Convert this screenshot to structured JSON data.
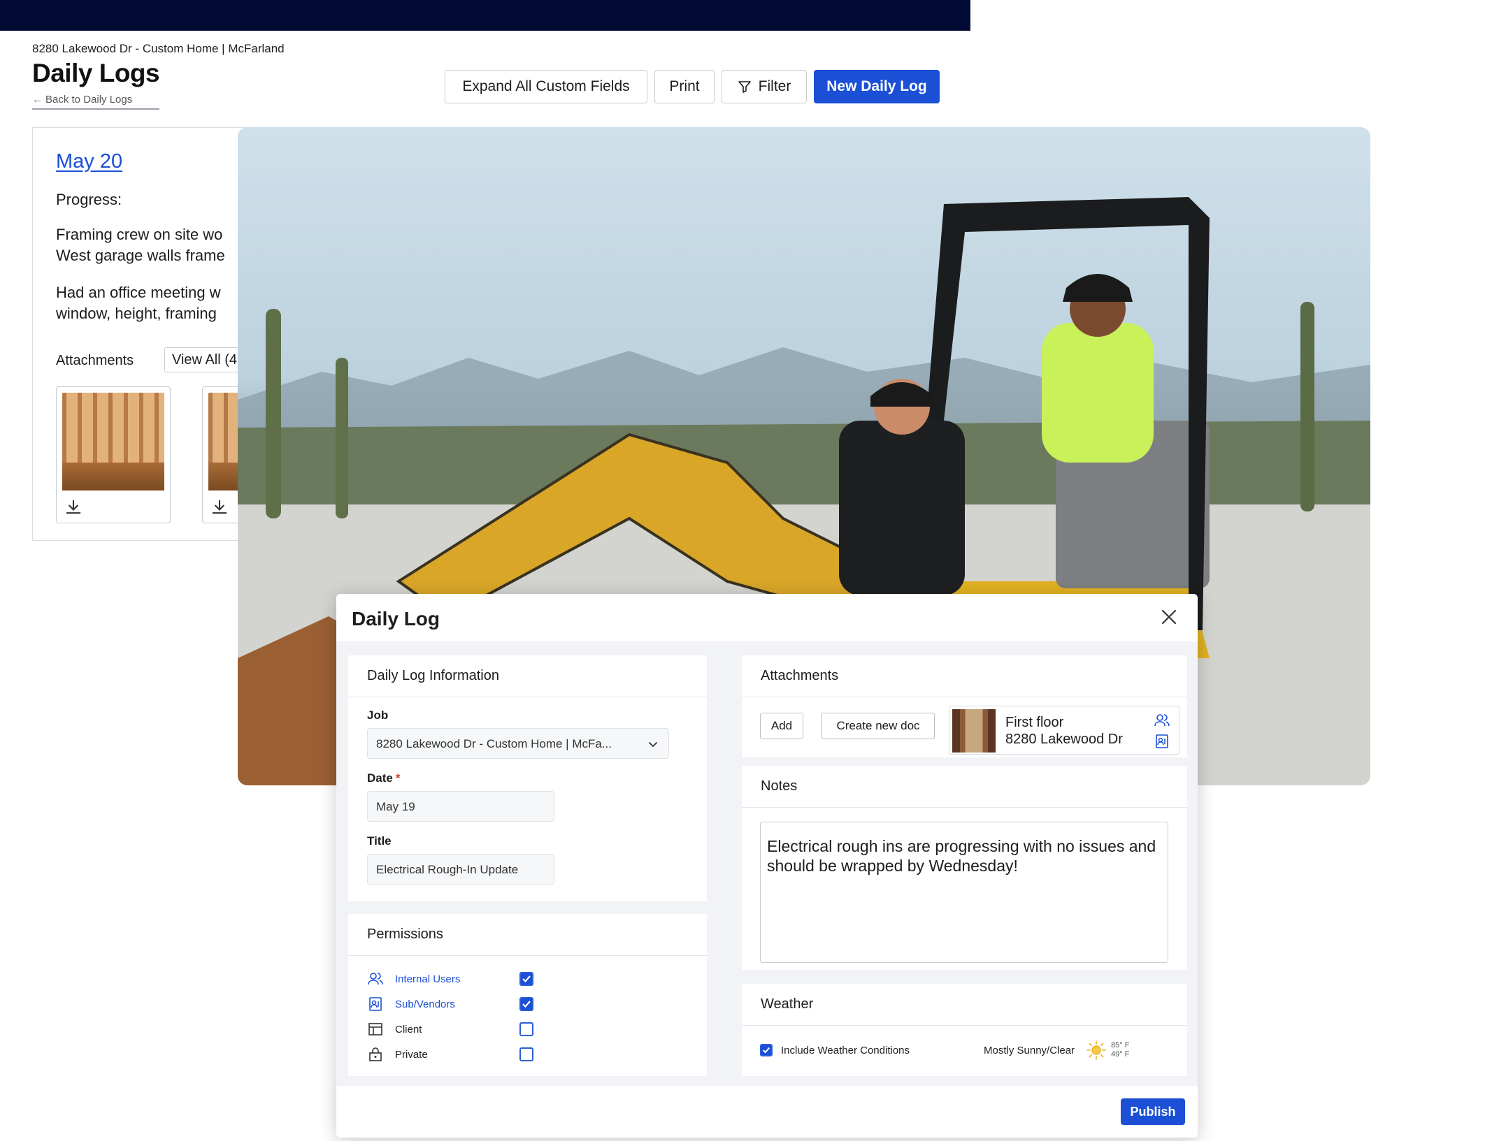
{
  "header": {
    "breadcrumb": "8280 Lakewood Dr - Custom Home | McFarland",
    "title": "Daily Logs",
    "back_label": "Back to Daily Logs"
  },
  "toolbar": {
    "expand_label": "Expand All Custom Fields",
    "print_label": "Print",
    "filter_label": "Filter",
    "new_label": "New Daily Log"
  },
  "log_card": {
    "date": "May 20",
    "progress_label": "Progress:",
    "paragraph_1_line_1": "Framing crew on site wo",
    "paragraph_1_line_2": "West garage walls frame",
    "paragraph_2_line_1": "Had an office meeting w",
    "paragraph_2_line_2": "window, height, framing",
    "attachments_label": "Attachments",
    "view_all_label": "View All (4"
  },
  "modal": {
    "title": "Daily Log",
    "info": {
      "heading": "Daily Log Information",
      "job_label": "Job",
      "job_value": "8280 Lakewood Dr - Custom Home | McFa...",
      "date_label": "Date",
      "required_mark": "*",
      "date_value": "May 19",
      "title_label": "Title",
      "title_value": "Electrical Rough-In Update"
    },
    "permissions": {
      "heading": "Permissions",
      "items": [
        {
          "label": "Internal Users",
          "checked": true
        },
        {
          "label": "Sub/Vendors",
          "checked": true
        },
        {
          "label": "Client",
          "checked": false
        },
        {
          "label": "Private",
          "checked": false
        }
      ]
    },
    "attachments": {
      "heading": "Attachments",
      "add_label": "Add",
      "create_label": "Create new doc",
      "file_name": "First floor",
      "file_job": "8280 Lakewood Dr"
    },
    "notes": {
      "heading": "Notes",
      "text": "Electrical rough ins are progressing with no issues and should be wrapped by Wednesday!"
    },
    "weather": {
      "heading": "Weather",
      "include_label": "Include Weather Conditions",
      "include_checked": true,
      "condition": "Mostly Sunny/Clear",
      "high": "85° F",
      "low": "49° F"
    },
    "publish_label": "Publish"
  },
  "colors": {
    "primary": "#1a4fd6",
    "topbar": "#020b33"
  }
}
